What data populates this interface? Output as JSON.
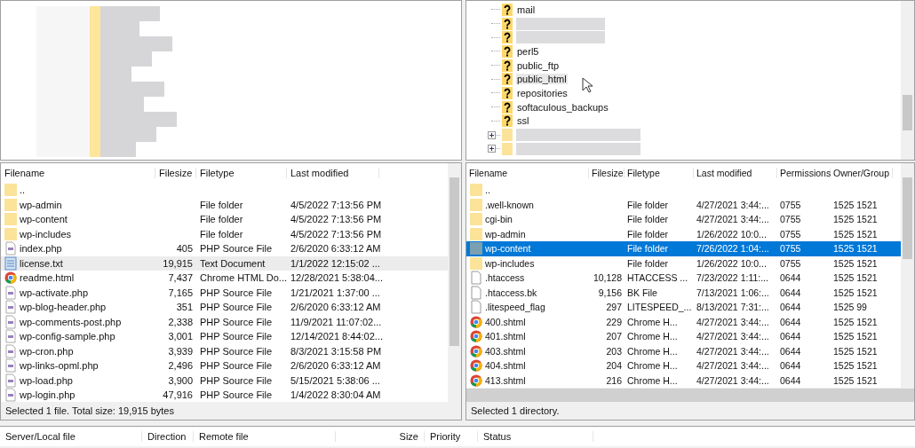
{
  "remote_tree": {
    "items": [
      {
        "kind": "unknown",
        "label": "mail",
        "hovered": false
      },
      {
        "kind": "unknown-blurred"
      },
      {
        "kind": "unknown-blurred"
      },
      {
        "kind": "unknown",
        "label": "perl5",
        "hovered": false
      },
      {
        "kind": "unknown",
        "label": "public_ftp",
        "hovered": false
      },
      {
        "kind": "unknown",
        "label": "public_html",
        "hovered": true
      },
      {
        "kind": "unknown",
        "label": "repositories",
        "hovered": false
      },
      {
        "kind": "unknown",
        "label": "softaculous_backups",
        "hovered": false
      },
      {
        "kind": "unknown",
        "label": "ssl",
        "hovered": false
      },
      {
        "kind": "folder-blurred"
      },
      {
        "kind": "folder-blurred"
      }
    ]
  },
  "local_list": {
    "focused": false,
    "columns": [
      "Filename",
      "Filesize",
      "Filetype",
      "Last modified"
    ],
    "rows": [
      {
        "kind": "folder",
        "name": "..",
        "selected": false
      },
      {
        "kind": "folder",
        "name": "wp-admin",
        "type": "File folder",
        "modified": "4/5/2022 7:13:56 PM",
        "selected": false
      },
      {
        "kind": "folder",
        "name": "wp-content",
        "type": "File folder",
        "modified": "4/5/2022 7:13:56 PM",
        "selected": false
      },
      {
        "kind": "folder",
        "name": "wp-includes",
        "type": "File folder",
        "modified": "4/5/2022 7:13:56 PM",
        "selected": false
      },
      {
        "kind": "php",
        "name": "index.php",
        "size": "405",
        "type": "PHP Source File",
        "modified": "2/6/2020 6:33:12 AM",
        "selected": false
      },
      {
        "kind": "text",
        "name": "license.txt",
        "size": "19,915",
        "type": "Text Document",
        "modified": "1/1/2022 12:15:02 ...",
        "selected": true
      },
      {
        "kind": "chrome",
        "name": "readme.html",
        "size": "7,437",
        "type": "Chrome HTML Do...",
        "modified": "12/28/2021 5:38:04...",
        "selected": false
      },
      {
        "kind": "php",
        "name": "wp-activate.php",
        "size": "7,165",
        "type": "PHP Source File",
        "modified": "1/21/2021 1:37:00 ...",
        "selected": false
      },
      {
        "kind": "php",
        "name": "wp-blog-header.php",
        "size": "351",
        "type": "PHP Source File",
        "modified": "2/6/2020 6:33:12 AM",
        "selected": false
      },
      {
        "kind": "php",
        "name": "wp-comments-post.php",
        "size": "2,338",
        "type": "PHP Source File",
        "modified": "11/9/2021 11:07:02...",
        "selected": false
      },
      {
        "kind": "php",
        "name": "wp-config-sample.php",
        "size": "3,001",
        "type": "PHP Source File",
        "modified": "12/14/2021 8:44:02...",
        "selected": false
      },
      {
        "kind": "php",
        "name": "wp-cron.php",
        "size": "3,939",
        "type": "PHP Source File",
        "modified": "8/3/2021 3:15:58 PM",
        "selected": false
      },
      {
        "kind": "php",
        "name": "wp-links-opml.php",
        "size": "2,496",
        "type": "PHP Source File",
        "modified": "2/6/2020 6:33:12 AM",
        "selected": false
      },
      {
        "kind": "php",
        "name": "wp-load.php",
        "size": "3,900",
        "type": "PHP Source File",
        "modified": "5/15/2021 5:38:06 ...",
        "selected": false
      },
      {
        "kind": "php",
        "name": "wp-login.php",
        "size": "47,916",
        "type": "PHP Source File",
        "modified": "1/4/2022 8:30:04 AM",
        "selected": false
      }
    ],
    "status": "Selected 1 file. Total size: 19,915 bytes"
  },
  "remote_list": {
    "focused": true,
    "columns": [
      "Filename",
      "Filesize",
      "Filetype",
      "Last modified",
      "Permissions",
      "Owner/Group"
    ],
    "rows": [
      {
        "kind": "folder",
        "name": "..",
        "selected": false
      },
      {
        "kind": "folder",
        "name": ".well-known",
        "type": "File folder",
        "modified": "4/27/2021 3:44:...",
        "perms": "0755",
        "owner": "1525 1521",
        "selected": false
      },
      {
        "kind": "folder",
        "name": "cgi-bin",
        "type": "File folder",
        "modified": "4/27/2021 3:44:...",
        "perms": "0755",
        "owner": "1525 1521",
        "selected": false
      },
      {
        "kind": "folder",
        "name": "wp-admin",
        "type": "File folder",
        "modified": "1/26/2022 10:0...",
        "perms": "0755",
        "owner": "1525 1521",
        "selected": false
      },
      {
        "kind": "folder",
        "name": "wp-content",
        "type": "File folder",
        "modified": "7/26/2022 1:04:...",
        "perms": "0755",
        "owner": "1525 1521",
        "selected": true
      },
      {
        "kind": "folder",
        "name": "wp-includes",
        "type": "File folder",
        "modified": "1/26/2022 10:0...",
        "perms": "0755",
        "owner": "1525 1521",
        "selected": false
      },
      {
        "kind": "file",
        "name": ".htaccess",
        "size": "10,128",
        "type": "HTACCESS ...",
        "modified": "7/23/2022 1:11:...",
        "perms": "0644",
        "owner": "1525 1521",
        "selected": false
      },
      {
        "kind": "file",
        "name": ".htaccess.bk",
        "size": "9,156",
        "type": "BK File",
        "modified": "7/13/2021 1:06:...",
        "perms": "0644",
        "owner": "1525 1521",
        "selected": false
      },
      {
        "kind": "file",
        "name": ".litespeed_flag",
        "size": "297",
        "type": "LITESPEED_...",
        "modified": "8/13/2021 7:31:...",
        "perms": "0644",
        "owner": "1525 99",
        "selected": false
      },
      {
        "kind": "chrome",
        "name": "400.shtml",
        "size": "229",
        "type": "Chrome H...",
        "modified": "4/27/2021 3:44:...",
        "perms": "0644",
        "owner": "1525 1521",
        "selected": false
      },
      {
        "kind": "chrome",
        "name": "401.shtml",
        "size": "207",
        "type": "Chrome H...",
        "modified": "4/27/2021 3:44:...",
        "perms": "0644",
        "owner": "1525 1521",
        "selected": false
      },
      {
        "kind": "chrome",
        "name": "403.shtml",
        "size": "203",
        "type": "Chrome H...",
        "modified": "4/27/2021 3:44:...",
        "perms": "0644",
        "owner": "1525 1521",
        "selected": false
      },
      {
        "kind": "chrome",
        "name": "404.shtml",
        "size": "204",
        "type": "Chrome H...",
        "modified": "4/27/2021 3:44:...",
        "perms": "0644",
        "owner": "1525 1521",
        "selected": false
      },
      {
        "kind": "chrome",
        "name": "413.shtml",
        "size": "216",
        "type": "Chrome H...",
        "modified": "4/27/2021 3:44:...",
        "perms": "0644",
        "owner": "1525 1521",
        "selected": false
      }
    ],
    "status": "Selected 1 directory."
  },
  "queue": {
    "columns": [
      "Server/Local file",
      "Direction",
      "Remote file",
      "Size",
      "Priority",
      "Status"
    ]
  }
}
